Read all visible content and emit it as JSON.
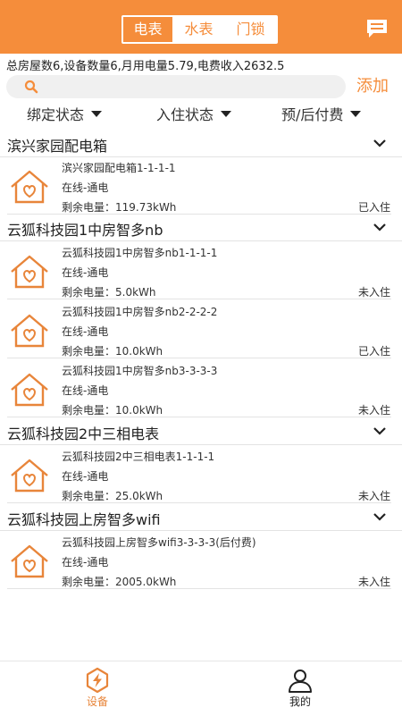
{
  "colors": {
    "accent": "#f58d3b",
    "text": "#222222",
    "divider": "#e3e3e3"
  },
  "header": {
    "tabs": [
      {
        "label": "电表",
        "active": true
      },
      {
        "label": "水表",
        "active": false
      },
      {
        "label": "门锁",
        "active": false
      }
    ],
    "message_icon": "message-icon"
  },
  "summary": "总房屋数6,设备数量6,月用电量5.79,电费收入2632.5",
  "search": {
    "placeholder": "",
    "icon": "search-icon"
  },
  "add_label": "添加",
  "filters": [
    {
      "label": "绑定状态"
    },
    {
      "label": "入住状态"
    },
    {
      "label": "预/后付费"
    }
  ],
  "groups": [
    {
      "title": "滨兴家园配电箱",
      "items": [
        {
          "name": "滨兴家园配电箱1-1-1-1",
          "status": "在线-通电",
          "power": "剩余电量：119.73kWh",
          "occupancy": "已入住"
        }
      ]
    },
    {
      "title": "云狐科技园1中房智多nb",
      "items": [
        {
          "name": "云狐科技园1中房智多nb1-1-1-1",
          "status": "在线-通电",
          "power": "剩余电量：5.0kWh",
          "occupancy": "未入住"
        },
        {
          "name": "云狐科技园1中房智多nb2-2-2-2",
          "status": "在线-通电",
          "power": "剩余电量：10.0kWh",
          "occupancy": "已入住"
        },
        {
          "name": "云狐科技园1中房智多nb3-3-3-3",
          "status": "在线-通电",
          "power": "剩余电量：10.0kWh",
          "occupancy": "未入住"
        }
      ]
    },
    {
      "title": "云狐科技园2中三相电表",
      "items": [
        {
          "name": "云狐科技园2中三相电表1-1-1-1",
          "status": "在线-通电",
          "power": "剩余电量：25.0kWh",
          "occupancy": "未入住"
        }
      ]
    },
    {
      "title": "云狐科技园上房智多wifi",
      "items": [
        {
          "name": "云狐科技园上房智多wifi3-3-3-3(后付费)",
          "status": "在线-通电",
          "power": "剩余电量：2005.0kWh",
          "occupancy": "未入住"
        }
      ]
    }
  ],
  "bottom_nav": [
    {
      "label": "设备",
      "icon": "device-lightning-icon",
      "active": true
    },
    {
      "label": "我的",
      "icon": "user-profile-icon",
      "active": false
    }
  ]
}
